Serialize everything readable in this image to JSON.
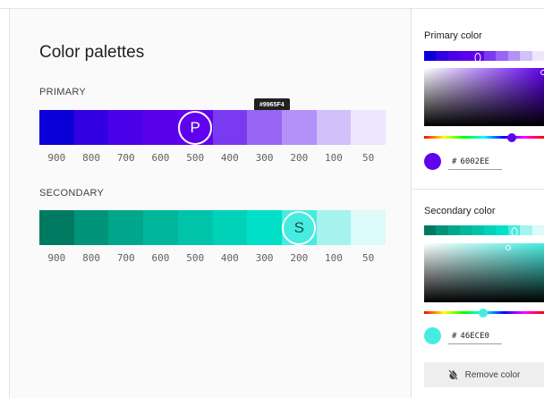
{
  "main": {
    "title": "Color palettes",
    "primary": {
      "label": "PRIMARY",
      "tooltip": "#9965F4",
      "marker": "P",
      "selected_index": 6,
      "marker_index": 4,
      "swatches": [
        "#0a00d8",
        "#3200e3",
        "#4a00e8",
        "#5c00ec",
        "#6002ee",
        "#7a3bf0",
        "#9965f4",
        "#b392f7",
        "#d2c0fa",
        "#eee6fd"
      ],
      "weights": [
        "900",
        "800",
        "700",
        "600",
        "500",
        "400",
        "300",
        "200",
        "100",
        "50"
      ]
    },
    "secondary": {
      "label": "SECONDARY",
      "marker": "S",
      "marker_index": 7,
      "swatches": [
        "#007961",
        "#00947a",
        "#00a78c",
        "#00b79c",
        "#00c4aa",
        "#00d2b7",
        "#00e0c8",
        "#46ece0",
        "#a6f2ed",
        "#dcfaf9"
      ],
      "weights": [
        "900",
        "800",
        "700",
        "600",
        "500",
        "400",
        "300",
        "200",
        "100",
        "50"
      ]
    }
  },
  "side": {
    "primary": {
      "title": "Primary color",
      "hex_label": "#",
      "hex_value": "6002EE",
      "color": "#6002ee",
      "hue_color": "#6002ee",
      "mini_swatches": [
        "#0a00d8",
        "#3200e3",
        "#4a00e8",
        "#5c00ec",
        "#6002ee",
        "#7a3bf0",
        "#9965f4",
        "#b392f7",
        "#d2c0fa",
        "#eee6fd"
      ],
      "mini_marker_index": 4,
      "saturation": 0.99,
      "value": 0.93,
      "hue_fraction": 0.73
    },
    "secondary": {
      "title": "Secondary color",
      "hex_label": "#",
      "hex_value": "46ECE0",
      "color": "#46ece0",
      "hue_color": "#46ece0",
      "mini_swatches": [
        "#007961",
        "#00947a",
        "#00a78c",
        "#00b79c",
        "#00c4aa",
        "#00d2b7",
        "#00e0c8",
        "#46ece0",
        "#a6f2ed",
        "#dcfaf9"
      ],
      "mini_marker_index": 7,
      "saturation": 0.7,
      "value": 0.93,
      "hue_fraction": 0.49
    },
    "remove_label": "Remove color",
    "remove_icon": "invert-colors-off-icon"
  }
}
